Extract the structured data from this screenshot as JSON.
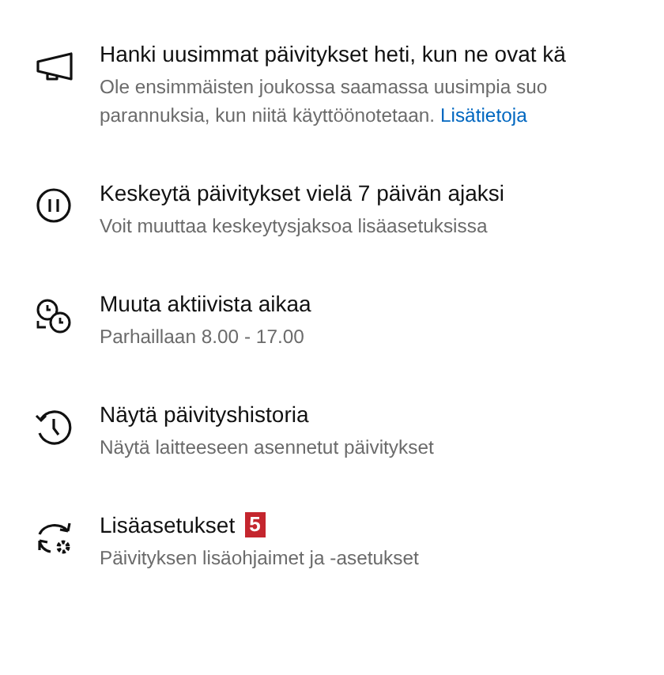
{
  "options": [
    {
      "kind": "megaphone",
      "title": "Hanki uusimmat päivitykset heti, kun ne ovat kä",
      "lines": [
        "Ole ensimmäisten joukossa saamassa uusimpia suo",
        "parannuksia, kun niitä käyttöönotetaan."
      ],
      "link": "Lisätietoja"
    },
    {
      "kind": "pause",
      "title": "Keskeytä päivitykset vielä 7 päivän ajaksi",
      "lines": [
        "Voit muuttaa keskeytysjaksoa lisäasetuksissa"
      ]
    },
    {
      "kind": "active-hours",
      "title": "Muuta aktiivista aikaa",
      "lines": [
        "Parhaillaan 8.00 - 17.00"
      ]
    },
    {
      "kind": "history",
      "title": "Näytä päivityshistoria",
      "lines": [
        "Näytä laitteeseen asennetut päivitykset"
      ]
    },
    {
      "kind": "advanced",
      "title": "Lisäasetukset",
      "badge": "5",
      "lines": [
        "Päivityksen lisäohjaimet ja -asetukset"
      ]
    }
  ]
}
